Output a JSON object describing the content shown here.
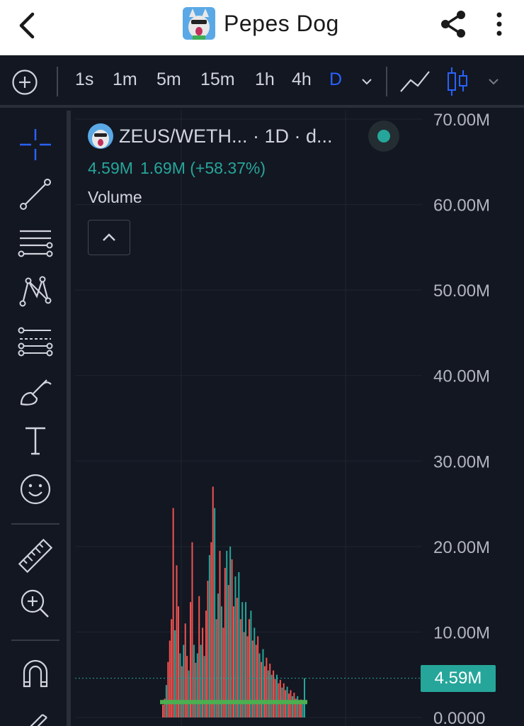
{
  "appbar": {
    "title": "Pepes Dog",
    "back_icon": "chevron-left-icon",
    "share_icon": "share-icon",
    "more_icon": "more-vertical-icon"
  },
  "toolbar": {
    "timeframes": [
      "1s",
      "1m",
      "5m",
      "15m",
      "1h",
      "4h",
      "D"
    ],
    "active_timeframe": "D",
    "accent_color": "#2962ff"
  },
  "left_tools": [
    "crosshair-icon",
    "trend-line-icon",
    "horizontal-lines-icon",
    "pattern-icon",
    "fib-retracement-icon",
    "brush-icon",
    "text-icon",
    "emoji-icon",
    "ruler-icon",
    "zoom-in-icon",
    "magnet-icon",
    "pencil-lock-icon"
  ],
  "legend": {
    "symbol": "ZEUS/WETH... · 1D · d...",
    "value": "4.59M",
    "change": "1.69M (+58.37%)",
    "indicator": "Volume",
    "up_color": "#26a69a",
    "down_color": "#ef5350"
  },
  "price_label": "4.59M",
  "chart_data": {
    "type": "bar",
    "series": [
      {
        "values": [
          1.5,
          2.2,
          3.8,
          6.5,
          9,
          11.5,
          24.5,
          10.2,
          17.8,
          13,
          7.5,
          6,
          8.5,
          11,
          7.2,
          5.5,
          13.5,
          20.5,
          8.5,
          6.4,
          7.5,
          14.2,
          8.5,
          10.5,
          7.2,
          12.5,
          16,
          19,
          20.5,
          27,
          24.5,
          11.5,
          14.5,
          19.5,
          13,
          10.5,
          17.5,
          19.5,
          15.5,
          20,
          18.5,
          13,
          16.5,
          14,
          17,
          11.5,
          13.5,
          10,
          13.5,
          9.5,
          11.5,
          12.5,
          9,
          10.5,
          8.5,
          9.5,
          7.5,
          6.5,
          8,
          6,
          7,
          5.5,
          6.3,
          5,
          5.5,
          4.5,
          5,
          4,
          4.4,
          3.5,
          4,
          3.2,
          3.6,
          2.8,
          3.2,
          2.5,
          2.9,
          2.2,
          2.5,
          1.8,
          2.1,
          1.6,
          4.59
        ],
        "directions": [
          "d",
          "d",
          "u",
          "d",
          "d",
          "d",
          "d",
          "u",
          "d",
          "d",
          "u",
          "d",
          "u",
          "d",
          "d",
          "u",
          "d",
          "d",
          "u",
          "d",
          "u",
          "d",
          "u",
          "d",
          "u",
          "d",
          "d",
          "u",
          "d",
          "d",
          "u",
          "d",
          "u",
          "d",
          "u",
          "d",
          "d",
          "u",
          "d",
          "u",
          "d",
          "d",
          "u",
          "d",
          "u",
          "d",
          "u",
          "d",
          "u",
          "d",
          "d",
          "u",
          "d",
          "u",
          "d",
          "d",
          "u",
          "d",
          "u",
          "d",
          "d",
          "u",
          "d",
          "u",
          "d",
          "d",
          "u",
          "d",
          "d",
          "u",
          "d",
          "d",
          "u",
          "d",
          "d",
          "u",
          "d",
          "d",
          "u",
          "d",
          "d",
          "u",
          "u"
        ]
      }
    ],
    "y_axis_labels": [
      "70.00M",
      "60.00M",
      "50.00M",
      "40.00M",
      "30.00M",
      "20.00M",
      "10.00M",
      "0.0000"
    ],
    "ylim": [
      0,
      70
    ],
    "current_value": 4.59,
    "grid": true
  }
}
